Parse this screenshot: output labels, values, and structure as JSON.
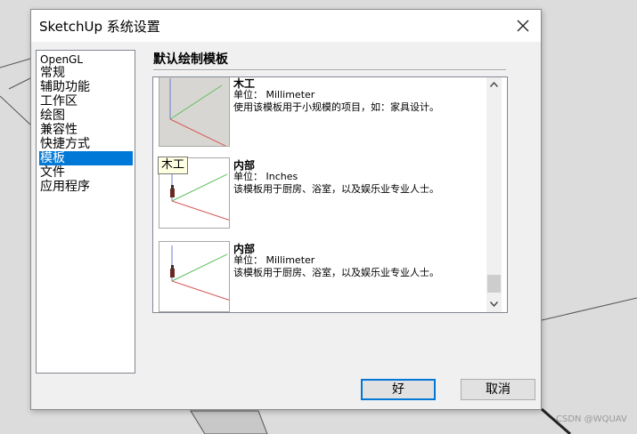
{
  "window": {
    "title": "SketchUp 系统设置",
    "close_icon": "close-icon"
  },
  "sidebar": {
    "items": [
      {
        "label": "OpenGL",
        "selected": false
      },
      {
        "label": "常规",
        "selected": false
      },
      {
        "label": "辅助功能",
        "selected": false
      },
      {
        "label": "工作区",
        "selected": false
      },
      {
        "label": "绘图",
        "selected": false
      },
      {
        "label": "兼容性",
        "selected": false
      },
      {
        "label": "快捷方式",
        "selected": false
      },
      {
        "label": "模板",
        "selected": true
      },
      {
        "label": "文件",
        "selected": false
      },
      {
        "label": "应用程序",
        "selected": false
      }
    ]
  },
  "main": {
    "section_title": "默认绘制模板",
    "templates": [
      {
        "name": "木工",
        "unit": "单位： Millimeter",
        "description": "使用该模板用于小规模的项目，如：家具设计。"
      },
      {
        "name": "内部",
        "unit": "单位： Inches",
        "description": "该模板用于厨房、浴室，以及娱乐业专业人士。"
      },
      {
        "name": "内部",
        "unit": "单位： Millimeter",
        "description": "该模板用于厨房、浴室，以及娱乐业专业人士。"
      }
    ],
    "tooltip": "木工"
  },
  "buttons": {
    "ok": "好",
    "cancel": "取消"
  },
  "watermark": "CSDN @WQUAV",
  "colors": {
    "accent": "#0078d7",
    "button_bg": "#e1e1e1"
  }
}
